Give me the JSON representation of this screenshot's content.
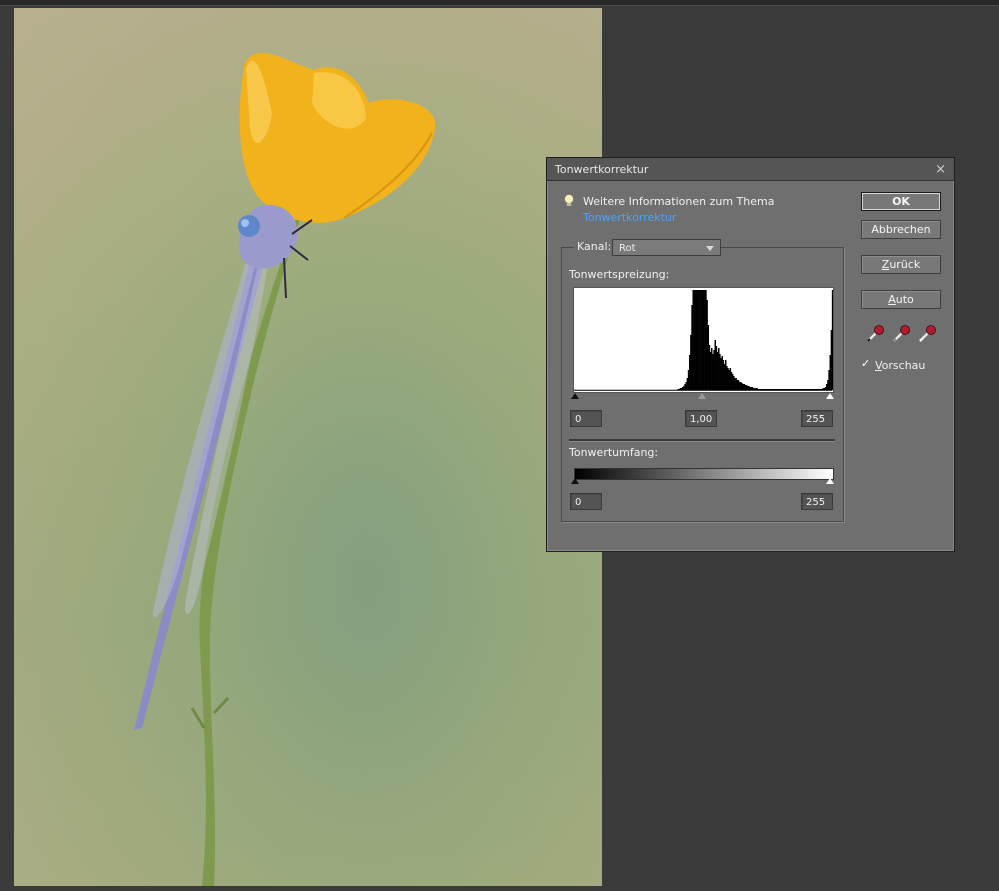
{
  "dialog": {
    "title": "Tonwertkorrektur",
    "close_glyph": "×",
    "info_heading": "Weitere Informationen zum Thema",
    "info_link": "Tonwertkorrektur",
    "buttons": {
      "ok": "OK",
      "cancel": "Abbrechen",
      "reset_prefix": "",
      "reset_underlined": "Z",
      "reset_rest": "urück",
      "auto_underlined": "A",
      "auto_rest": "uto"
    },
    "channel_label": "Kanal:",
    "channel_selected": "Rot",
    "input_levels_label": "Tonwertspreizung:",
    "input_black": "0",
    "input_gamma": "1,00",
    "input_white": "255",
    "output_levels_label": "Tonwertumfang:",
    "output_black": "0",
    "output_white": "255",
    "preview_underlined": "V",
    "preview_rest": "orschau",
    "preview_checked": true,
    "icons": {
      "info": "lightbulb-icon",
      "droppers": [
        "black-eyedropper-icon",
        "gray-eyedropper-icon",
        "white-eyedropper-icon"
      ]
    }
  },
  "histogram": {
    "channel": "Rot",
    "bins": [
      0,
      0,
      0,
      0,
      0,
      0,
      0,
      0,
      0,
      0,
      0,
      0,
      0,
      0,
      0,
      0,
      0,
      0,
      0,
      0,
      0,
      0,
      0,
      0,
      0,
      0,
      0,
      0,
      0,
      0,
      0,
      0,
      0,
      0,
      0,
      0,
      0,
      0,
      0,
      0,
      0,
      0,
      0,
      0,
      0,
      0,
      0,
      0,
      0,
      0,
      0,
      0,
      0,
      0,
      0,
      0,
      0,
      0,
      0,
      0,
      0,
      0,
      0,
      0,
      0,
      0,
      0,
      0,
      0,
      0,
      0,
      0,
      0,
      0,
      0,
      0,
      0,
      0,
      0,
      0,
      0,
      0,
      0,
      0,
      0,
      0,
      0,
      0,
      0,
      0.01,
      0.01,
      0.02,
      0.02,
      0.03,
      0.04,
      0.06,
      0.08,
      0.12,
      0.2,
      0.35,
      0.55,
      0.85,
      1,
      1,
      1,
      1,
      1,
      1,
      1,
      1,
      1,
      1,
      1,
      1,
      0.9,
      0.65,
      0.45,
      0.38,
      0.42,
      0.36,
      0.4,
      0.5,
      0.44,
      0.38,
      0.42,
      0.36,
      0.32,
      0.34,
      0.3,
      0.26,
      0.3,
      0.24,
      0.22,
      0.2,
      0.22,
      0.18,
      0.16,
      0.14,
      0.12,
      0.12,
      0.1,
      0.1,
      0.08,
      0.08,
      0.07,
      0.06,
      0.06,
      0.05,
      0.05,
      0.04,
      0.04,
      0.03,
      0.03,
      0.03,
      0.02,
      0.02,
      0.02,
      0.02,
      0.01,
      0.01,
      0.01,
      0.01,
      0.01,
      0.01,
      0.01,
      0.01,
      0.01,
      0.01,
      0.01,
      0.01,
      0.01,
      0.01,
      0.01,
      0.01,
      0.01,
      0.01,
      0.01,
      0.01,
      0.01,
      0.01,
      0.01,
      0.01,
      0.01,
      0.01,
      0.01,
      0.01,
      0.01,
      0.01,
      0.01,
      0.01,
      0.01,
      0.01,
      0.01,
      0.01,
      0.01,
      0.01,
      0.01,
      0.01,
      0.01,
      0.01,
      0.01,
      0.01,
      0.01,
      0.01,
      0.01,
      0.01,
      0.01,
      0.01,
      0.01,
      0.01,
      0.01,
      0.01,
      0.01,
      0.01,
      0.02,
      0.02,
      0.03,
      0.06,
      0.1,
      0.2,
      0.35,
      0.6,
      1
    ]
  },
  "colors": {
    "dialog_bg": "#6f6f6f",
    "workspace_bg": "#3b3b3b",
    "link": "#4da3ff",
    "flower": "#f2b21c",
    "damselfly": "#8c8cc4"
  }
}
